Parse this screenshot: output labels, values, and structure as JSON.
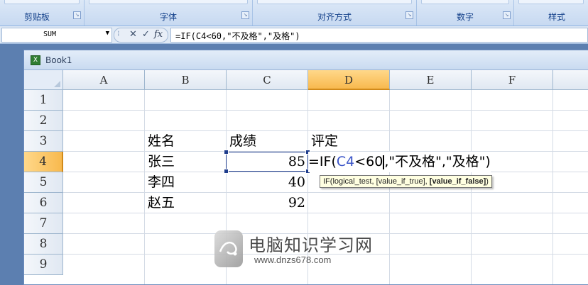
{
  "ribbon": {
    "groups": [
      {
        "label": "剪贴板"
      },
      {
        "label": "字体"
      },
      {
        "label": "对齐方式"
      },
      {
        "label": "数字"
      },
      {
        "label": "样式"
      }
    ]
  },
  "formula_bar": {
    "name_box": "SUM",
    "cancel_icon": "✕",
    "enter_icon": "✓",
    "fx_label": "fx",
    "formula": "=IF(C4<60,\"不及格\",\"及格\")"
  },
  "window": {
    "title": "Book1"
  },
  "sheet": {
    "columns": [
      "A",
      "B",
      "C",
      "D",
      "E",
      "F"
    ],
    "active_column": "D",
    "rows": [
      "1",
      "2",
      "3",
      "4",
      "5",
      "6",
      "7",
      "8",
      "9"
    ],
    "active_row": "4",
    "cells": {
      "B3": "姓名",
      "C3": "成绩",
      "D3": "评定",
      "B4": "张三",
      "C4": "85",
      "B5": "李四",
      "C5": "40",
      "B6": "赵五",
      "C6": "92"
    },
    "editing": {
      "prefix": "=IF(",
      "ref": "C4",
      "suffix_before_caret": "<60",
      "suffix_after_caret": ",\"不及格\",\"及格\")"
    },
    "tooltip": {
      "head": "IF(logical_test, [value_if_true], ",
      "bold": "[value_if_false]",
      "tail": ")"
    }
  },
  "watermark": {
    "title": "电脑知识学习网",
    "url": "www.dnzs678.com"
  }
}
